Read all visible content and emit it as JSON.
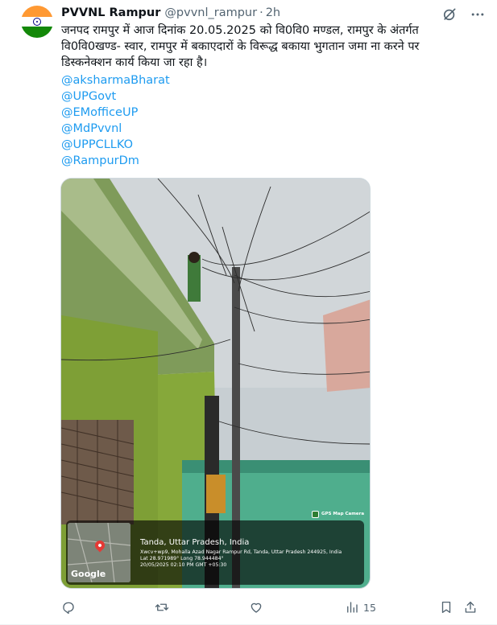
{
  "post": {
    "author_name": "PVVNL Rampur",
    "author_handle": "@pvvnl_rampur",
    "separator": "·",
    "time": "2h",
    "text_lines": [
      "जनपद रामपुर में आज दिनांक 20.05.2025 को वि0वि0 मण्डल, रामपुर के अंतर्गत",
      "वि0वि0खण्ड- स्वार, रामपुर में बकाएदारों के विरूद्ध बकाया भुगतान जमा ना करने पर",
      "डिस्कनेक्शन कार्य किया जा रहा है।"
    ],
    "mentions": [
      "@aksharmaBharat",
      "@UPGovt",
      "@EMofficeUP",
      "@MdPvvnl",
      "@UPPCLLKO",
      "@RampurDm"
    ]
  },
  "media": {
    "camera_badge": "GPS Map Camera",
    "map_logo": "Google",
    "location_title": "Tanda, Uttar Pradesh, India",
    "address": "Xwcv+wp9, Mohalla Azad Nagar Rampur Rd, Tanda, Uttar Pradesh 244925, India",
    "latlong": "Lat 28.971989° Long 78.944484°",
    "datetime": "20/05/2025 02:10 PM GMT +05:30"
  },
  "actions": {
    "views_count": "15"
  },
  "icons": {
    "grok": "grok-icon",
    "more": "more-icon",
    "reply": "reply-icon",
    "repost": "repost-icon",
    "like": "like-icon",
    "views": "views-icon",
    "bookmark": "bookmark-icon",
    "share": "share-icon"
  },
  "colors": {
    "link": "#1d9bf0",
    "muted": "#536471",
    "text": "#0f1419"
  }
}
